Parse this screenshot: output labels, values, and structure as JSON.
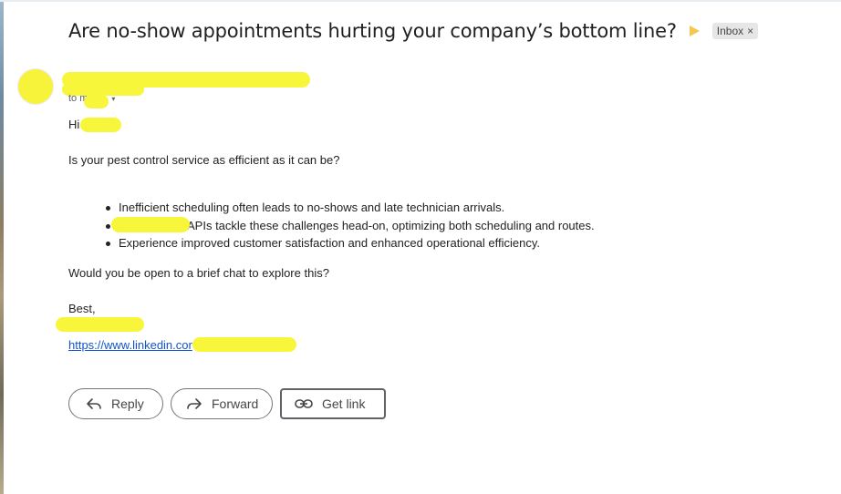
{
  "email": {
    "subject": "Are no-show appointments hurting your company’s bottom line?",
    "label_chip": "Inbox",
    "label_chip_remove": "×",
    "to_line": "to m",
    "greeting": "Hi",
    "intro": "Is your pest control service as efficient as it can be?",
    "bullets": [
      "Inefficient scheduling often leads to no-shows and late technician arrivals.",
      "APIs tackle these challenges head-on, optimizing both scheduling and routes.",
      "Experience improved customer satisfaction and enhanced operational efficiency."
    ],
    "question": "Would you be open to a brief chat to explore this?",
    "signoff": "Best,",
    "link": "https://www.linkedin.cor"
  },
  "actions": {
    "reply": "Reply",
    "forward": "Forward",
    "get_link": "Get link"
  },
  "colors": {
    "redaction": "#f8f63a",
    "link": "#1155cc",
    "importance": "#f2c94c"
  }
}
